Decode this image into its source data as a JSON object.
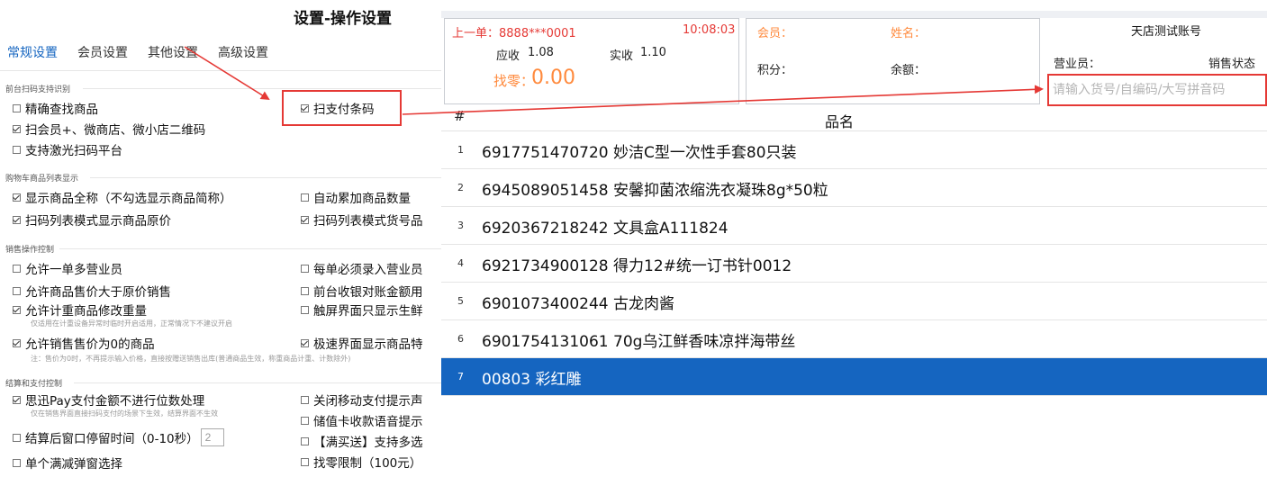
{
  "settings": {
    "title": "设置-操作设置",
    "tabs": [
      "常规设置",
      "会员设置",
      "其他设置",
      "高级设置"
    ],
    "groups": {
      "scan": {
        "title": "前台扫码支持识别",
        "options": [
          {
            "label": "精确查找商品",
            "checked": false
          },
          {
            "label": "扫会员+、微商店、微小店二维码",
            "checked": true
          },
          {
            "label": "支持激光扫码平台",
            "checked": false
          },
          {
            "label": "扫支付条码",
            "checked": true
          }
        ]
      },
      "cart": {
        "title": "购物车商品列表显示",
        "options": [
          {
            "label": "显示商品全称（不勾选显示商品简称）",
            "checked": true
          },
          {
            "label": "扫码列表模式显示商品原价",
            "checked": true
          },
          {
            "label": "自动累加商品数量",
            "checked": false
          },
          {
            "label": "扫码列表模式货号品",
            "checked": true
          }
        ]
      },
      "sales": {
        "title": "销售操作控制",
        "options": [
          {
            "label": "允许一单多营业员",
            "checked": false
          },
          {
            "label": "允许商品售价大于原价销售",
            "checked": false
          },
          {
            "label": "允许计重商品修改重量",
            "checked": true
          },
          {
            "label": "允许销售售价为0的商品",
            "checked": true
          },
          {
            "label": "每单必须录入营业员",
            "checked": false
          },
          {
            "label": "前台收银对账金额用",
            "checked": false
          },
          {
            "label": "触屏界面只显示生鲜",
            "checked": false
          },
          {
            "label": "极速界面显示商品特",
            "checked": true
          }
        ],
        "hint_weight": "仅适用在计重设备异常时临时开启适用，正常情况下不建议开启",
        "hint_zero": "注：售价为0时，不再提示输入价格，直接按赠送销售出库(普通商品生效，称重商品计重、计数除外)"
      },
      "pay": {
        "title": "结算和支付控制",
        "options": [
          {
            "label": "思迅Pay支付金额不进行位数处理",
            "checked": true
          },
          {
            "label": "结算后窗口停留时间（0-10秒）",
            "checked": false
          },
          {
            "label": "单个满减弹窗选择",
            "checked": false
          },
          {
            "label": "关闭移动支付提示声",
            "checked": false
          },
          {
            "label": "储值卡收款语音提示",
            "checked": false
          },
          {
            "label": "【满买送】支持多选",
            "checked": false
          },
          {
            "label": "找零限制（100元）",
            "checked": false
          }
        ],
        "hint_pay": "仅在销售界面直接扫码支付的场景下生效，结算界面不生效",
        "stay_seconds": "2"
      }
    }
  },
  "cashier": {
    "last_order_label": "上一单：8888***0001",
    "last_order_time": "10:08:03",
    "receivable_label": "应收",
    "receivable": "1.08",
    "received_label": "实收",
    "received": "1.10",
    "change_label": "找零：",
    "change": "0.00",
    "member_label": "会员：",
    "name_label": "姓名：",
    "points_label": "积分：",
    "balance_label": "余额：",
    "account_name": "天店测试账号",
    "clerk_label": "营业员：",
    "sale_status_label": "销售状态",
    "search_placeholder": "请输入货号/自编码/大写拼音码",
    "table": {
      "col_index": "#",
      "col_name": "品名",
      "rows": [
        {
          "index": "1",
          "name": "6917751470720 妙洁C型一次性手套80只装"
        },
        {
          "index": "2",
          "name": "6945089051458 安馨抑菌浓缩洗衣凝珠8g*50粒"
        },
        {
          "index": "3",
          "name": "6920367218242 文具盒A111824"
        },
        {
          "index": "4",
          "name": "6921734900128 得力12#统一订书针0012"
        },
        {
          "index": "5",
          "name": "6901073400244 古龙肉酱"
        },
        {
          "index": "6",
          "name": "6901754131061 70g乌江鲜香味凉拌海带丝"
        },
        {
          "index": "7",
          "name": "00803 彩红雕"
        }
      ],
      "selected_index": "7"
    }
  },
  "colors": {
    "accent": "#1565c0",
    "highlight_red": "#e53935",
    "change_orange": "#ff8a3d"
  }
}
